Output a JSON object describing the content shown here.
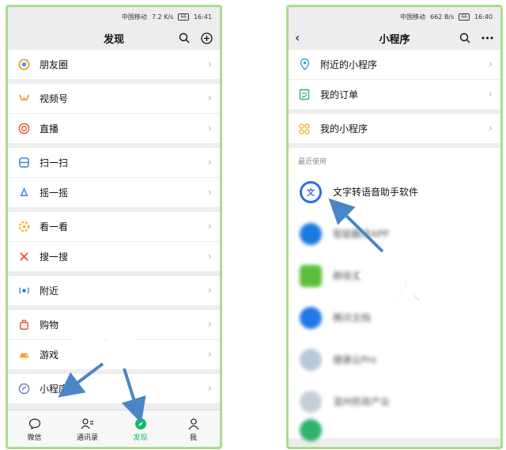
{
  "left": {
    "status": {
      "carrier": "中国移动",
      "speed": "7.2 K/s",
      "battery": "66",
      "time": "16:41"
    },
    "title": "发现",
    "groups": [
      [
        {
          "label": "朋友圈",
          "icon": "moments-icon"
        }
      ],
      [
        {
          "label": "视频号",
          "icon": "channels-icon"
        },
        {
          "label": "直播",
          "icon": "live-icon"
        }
      ],
      [
        {
          "label": "扫一扫",
          "icon": "scan-icon"
        },
        {
          "label": "摇一摇",
          "icon": "shake-icon"
        }
      ],
      [
        {
          "label": "看一看",
          "icon": "top-stories-icon"
        },
        {
          "label": "搜一搜",
          "icon": "search-icon"
        }
      ],
      [
        {
          "label": "附近",
          "icon": "nearby-icon"
        }
      ],
      [
        {
          "label": "购物",
          "icon": "shopping-icon"
        },
        {
          "label": "游戏",
          "icon": "games-icon"
        }
      ],
      [
        {
          "label": "小程序",
          "icon": "mini-program-icon"
        }
      ]
    ],
    "tabs": [
      {
        "label": "微信",
        "icon": "chat-icon"
      },
      {
        "label": "通讯录",
        "icon": "contacts-icon"
      },
      {
        "label": "发现",
        "icon": "discover-icon"
      },
      {
        "label": "我",
        "icon": "me-icon"
      }
    ],
    "annotation": "点击"
  },
  "right": {
    "status": {
      "carrier": "中国移动",
      "speed": "662 B/s",
      "battery": "66",
      "time": "16:40"
    },
    "title": "小程序",
    "menu": [
      {
        "label": "附近的小程序",
        "icon": "location-icon"
      },
      {
        "label": "我的订单",
        "icon": "order-icon"
      }
    ],
    "my_mini_programs": "我的小程序",
    "recent_label": "最近使用",
    "recent": [
      {
        "label": "文字转语音助手软件",
        "color": "#2f6fe0"
      },
      {
        "label": "智能翻译APP",
        "color": "#1a7ae0"
      },
      {
        "label": "群收龙",
        "color": "#5bbf3c"
      },
      {
        "label": "腾讯文档",
        "color": "#1e78e6"
      },
      {
        "label": "健康云Pro",
        "color": "#b9c8d8"
      },
      {
        "label": "温州民政产业",
        "color": "#c5cfdb"
      }
    ],
    "annotation": "进入"
  },
  "colors": {
    "accent": "#07c160",
    "frame": "#a9dd8e",
    "annotation": "#4a86c5"
  }
}
